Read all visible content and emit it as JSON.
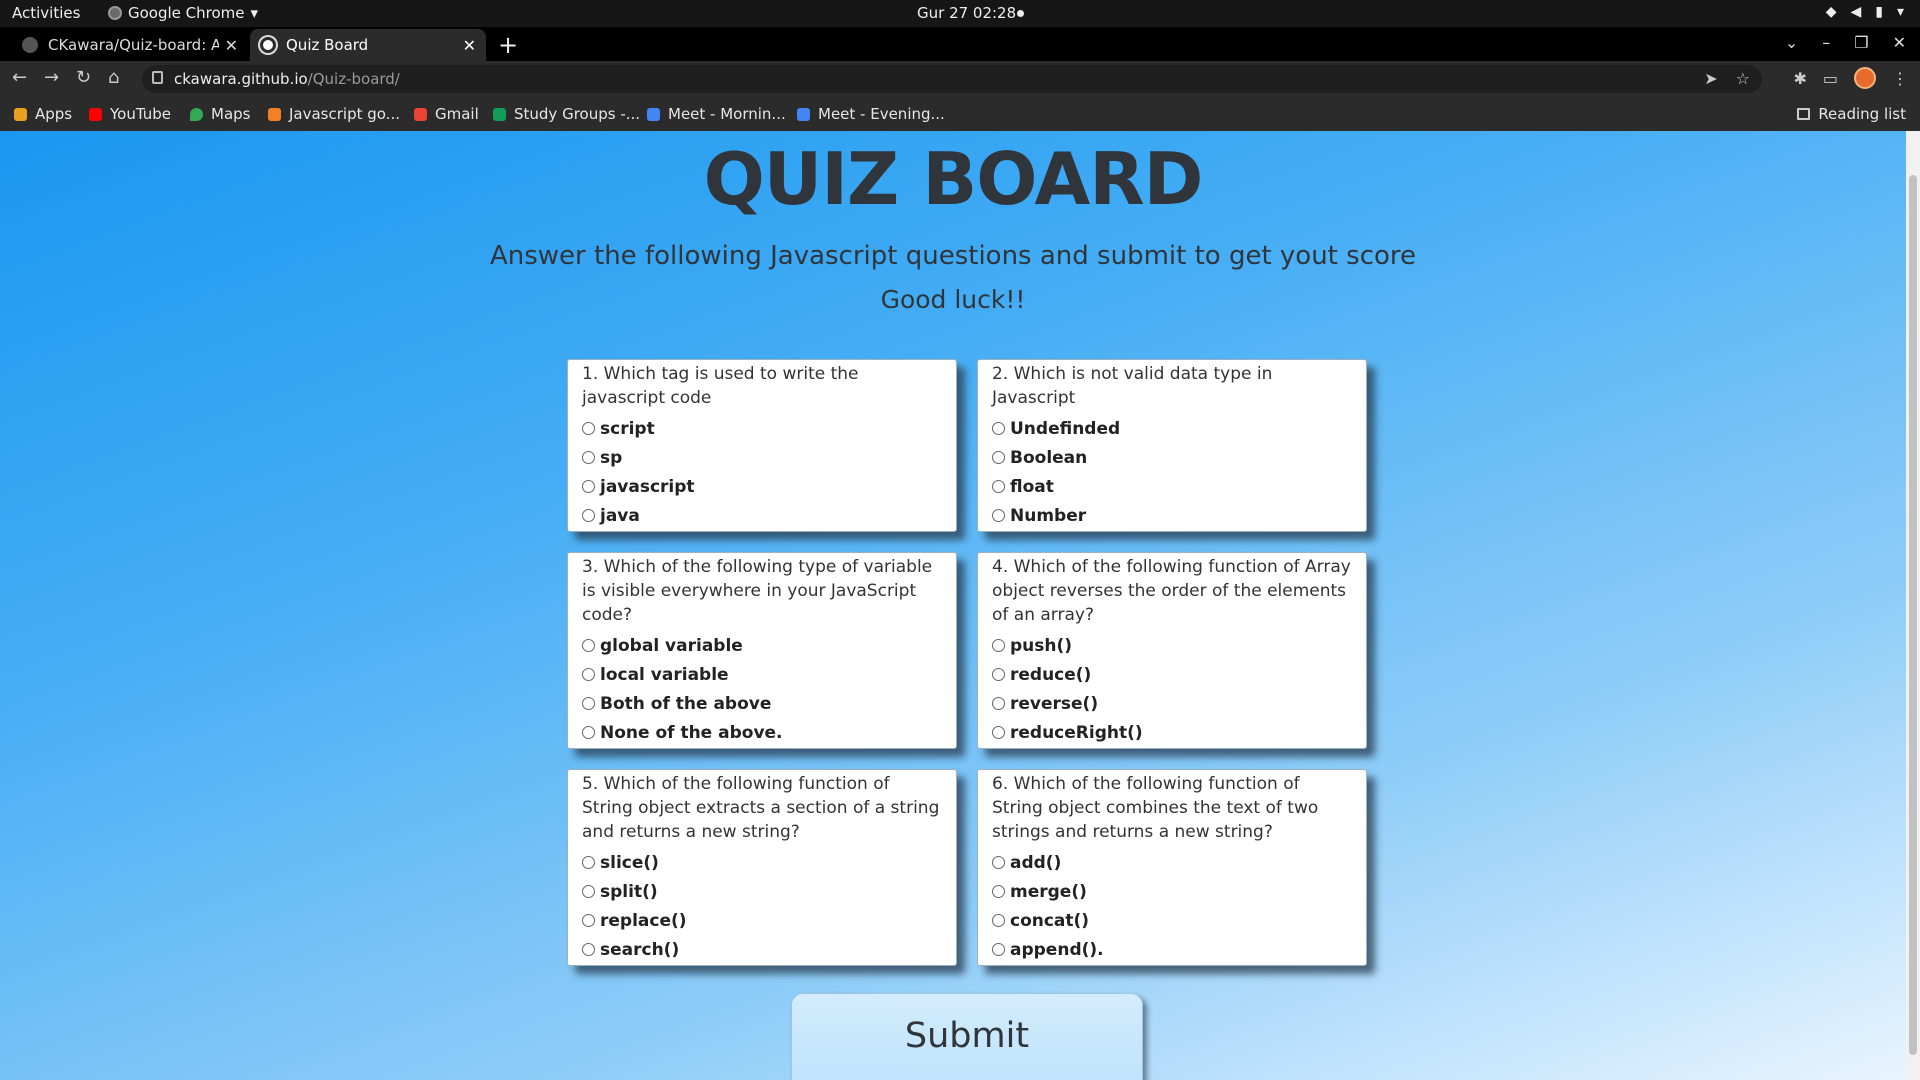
{
  "system_bar": {
    "activities": "Activities",
    "app_name": "Google Chrome",
    "clock": "Gur 27  02:28"
  },
  "tabs": [
    {
      "title": "CKawara/Quiz-board: A w",
      "active": false
    },
    {
      "title": "Quiz Board",
      "active": true
    }
  ],
  "address_bar": {
    "domain": "ckawara.github.io",
    "path": "/Quiz-board/"
  },
  "bookmarks": [
    {
      "label": "Apps",
      "icon": "apps-grid-icon",
      "color": "#e8a020"
    },
    {
      "label": "YouTube",
      "icon": "youtube-icon",
      "color": "#ff0000"
    },
    {
      "label": "Maps",
      "icon": "maps-pin-icon",
      "color": "#34a853"
    },
    {
      "label": "Javascript go...",
      "icon": "stackoverflow-icon",
      "color": "#f48024"
    },
    {
      "label": "Gmail",
      "icon": "gmail-icon",
      "color": "#ea4335"
    },
    {
      "label": "Study Groups -...",
      "icon": "sheets-icon",
      "color": "#0f9d58"
    },
    {
      "label": "Meet - Mornin...",
      "icon": "calendar-icon",
      "color": "#4285f4"
    },
    {
      "label": "Meet - Evening...",
      "icon": "calendar-icon",
      "color": "#4285f4"
    }
  ],
  "reading_list": "Reading list",
  "page": {
    "title": "QUIZ BOARD",
    "subtitle": "Answer the following Javascript questions and submit to get yout score",
    "good_luck": "Good luck!!",
    "submit_label": "Submit",
    "questions": [
      {
        "text": "1. Which tag is used to write the javascript code",
        "options": [
          "script",
          "sp",
          "javascript",
          "java"
        ]
      },
      {
        "text": "2. Which is not valid data type in Javascript",
        "options": [
          "Undefinded",
          "Boolean",
          "float",
          "Number"
        ]
      },
      {
        "text": "3. Which of the following type of variable is visible everywhere in your JavaScript code?",
        "options": [
          "global variable",
          "local variable",
          "Both of the above",
          "None of the above."
        ]
      },
      {
        "text": "4. Which of the following function of Array object reverses the order of the elements of an array?",
        "options": [
          "push()",
          "reduce()",
          "reverse()",
          "reduceRight()"
        ]
      },
      {
        "text": "5. Which of the following function of String object extracts a section of a string and returns a new string?",
        "options": [
          "slice()",
          "split()",
          "replace()",
          "search()"
        ]
      },
      {
        "text": "6. Which of the following function of String object combines the text of two strings and returns a new string?",
        "options": [
          "add()",
          "merge()",
          "concat()",
          "append()."
        ]
      }
    ]
  }
}
